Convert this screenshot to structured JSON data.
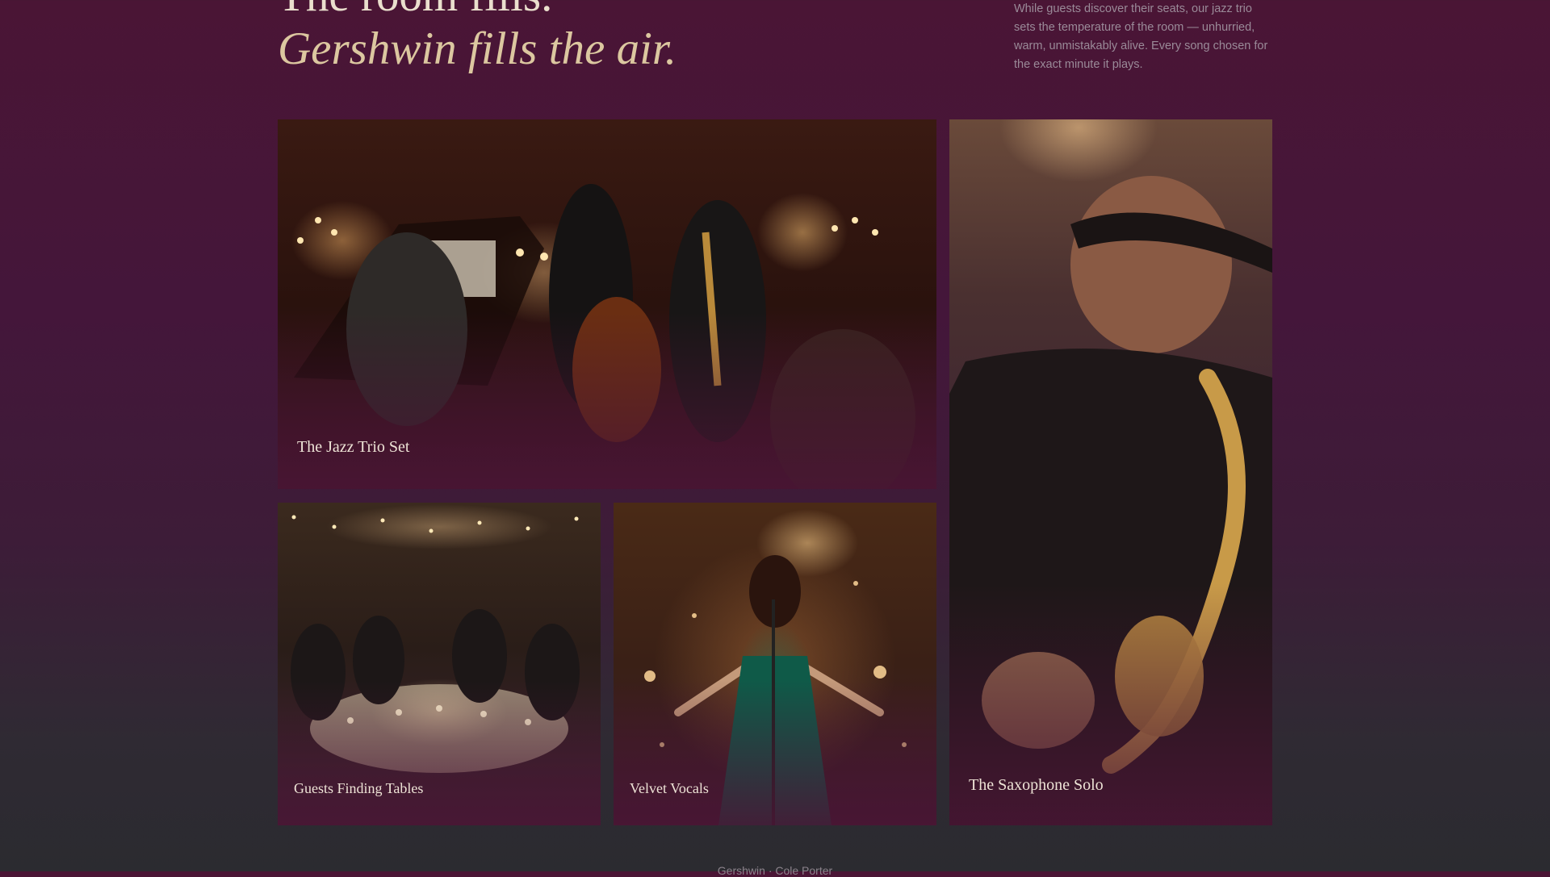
{
  "hero": {
    "title_line1": "The room fills.",
    "title_line2": "Gershwin fills the air.",
    "intro": "While guests discover their seats, our jazz trio sets the temperature of the room — unhurried, warm, unmistakably alive. Every song chosen for the exact minute it plays."
  },
  "gallery": {
    "tiles": [
      {
        "caption": "The Jazz Trio Set"
      },
      {
        "caption": "Guests Finding Tables"
      },
      {
        "caption": "Velvet Vocals"
      },
      {
        "caption": "The Saxophone Solo"
      }
    ]
  },
  "footer": {
    "text": "Gershwin · Cole Porter"
  },
  "colors": {
    "background_top": "#4a1535",
    "background_bottom": "#2b2b30",
    "headline": "#eadfcd",
    "headline_italic": "#dcc7a0",
    "body_text": "#9a8a98"
  }
}
